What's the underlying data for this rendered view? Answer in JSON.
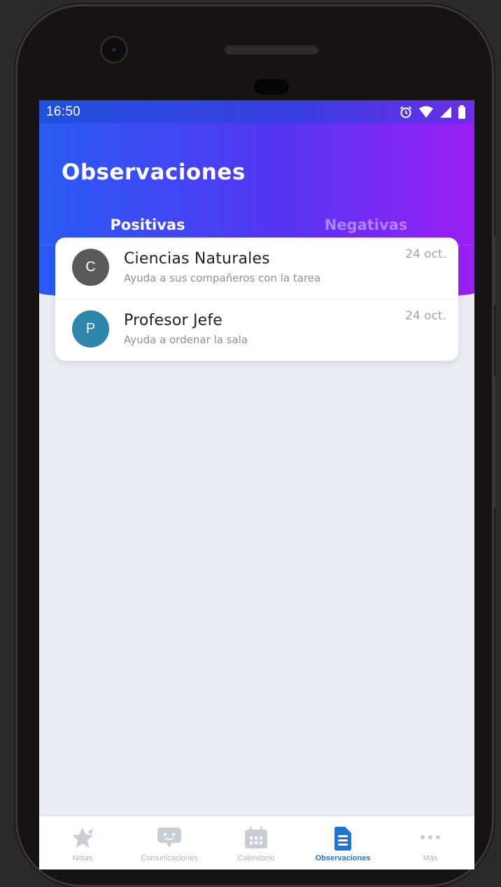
{
  "status_bar": {
    "time": "16:50",
    "icons": [
      "alarm-icon",
      "wifi-icon",
      "signal-icon",
      "battery-icon"
    ]
  },
  "header": {
    "title": "Observaciones",
    "tabs": [
      {
        "label": "Positivas",
        "active": true
      },
      {
        "label": "Negativas",
        "active": false
      }
    ]
  },
  "observations": [
    {
      "initial": "C",
      "avatar_color": "#5a5a5a",
      "title": "Ciencias Naturales",
      "subtitle": "Ayuda a sus compañeros con la tarea",
      "date": "24 oct."
    },
    {
      "initial": "P",
      "avatar_color": "#2e86ab",
      "title": "Profesor Jefe",
      "subtitle": "Ayuda a ordenar la sala",
      "date": "24 oct."
    }
  ],
  "bottom_nav": [
    {
      "label": "Notas",
      "icon": "star-icon",
      "active": false
    },
    {
      "label": "Comunicaciones",
      "icon": "chat-icon",
      "active": false
    },
    {
      "label": "Calendario",
      "icon": "calendar-icon",
      "active": false
    },
    {
      "label": "Observaciones",
      "icon": "document-icon",
      "active": true
    },
    {
      "label": "Más",
      "icon": "more-icon",
      "active": false
    }
  ],
  "colors": {
    "header_gradient_start": "#2a5bf4",
    "header_gradient_end": "#9b1ef5",
    "accent": "#1f74d6",
    "background": "#e9edf1"
  }
}
